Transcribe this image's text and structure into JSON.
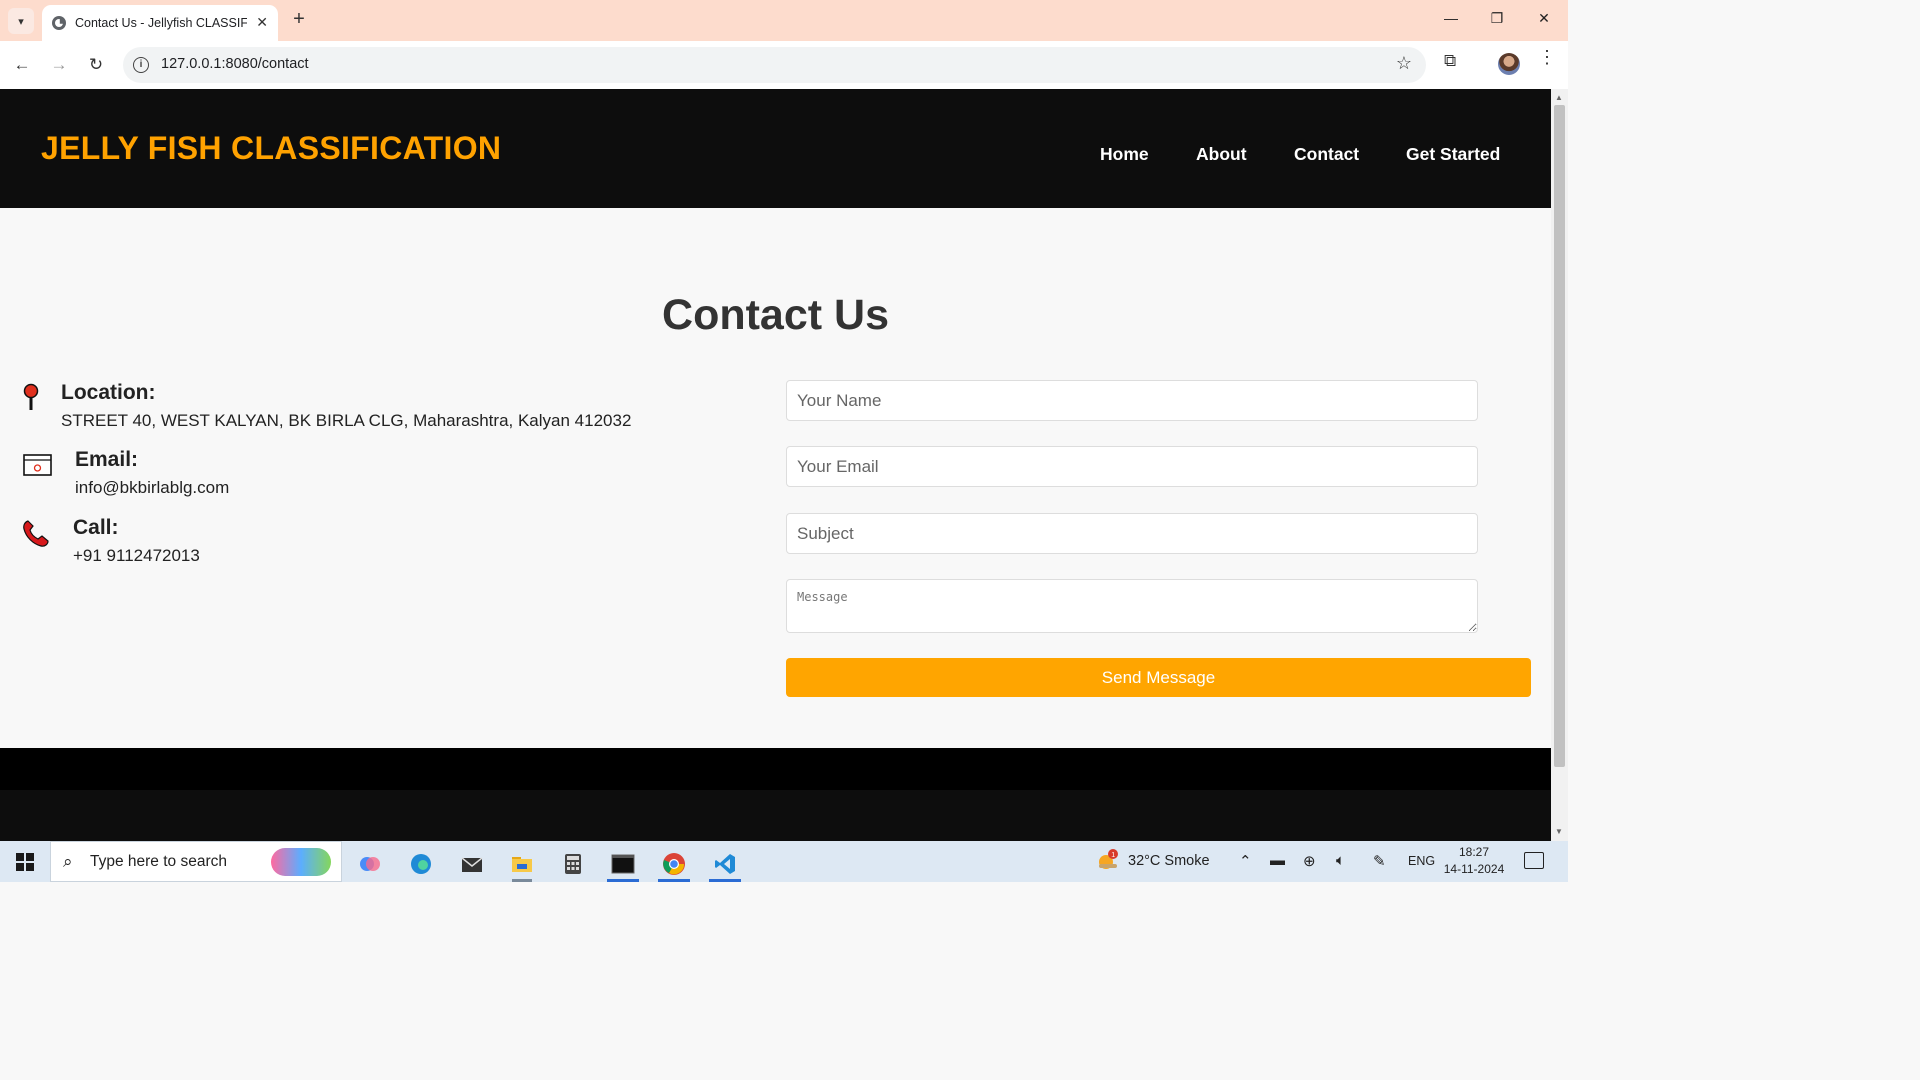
{
  "browser": {
    "tab_title": "Contact Us - Jellyfish CLASSIFICATION",
    "url": "127.0.0.1:8080/contact"
  },
  "site": {
    "title": "JELLY FISH CLASSIFICATION",
    "nav": [
      "Home",
      "About",
      "Contact",
      "Get Started"
    ],
    "accent_color": "#ffa500"
  },
  "page": {
    "heading": "Contact Us",
    "location": {
      "label": "Location:",
      "value": "STREET 40, WEST KALYAN, BK BIRLA CLG, Maharashtra, Kalyan 412032"
    },
    "email": {
      "label": "Email:",
      "value": "info@bkbirlablg.com"
    },
    "call": {
      "label": "Call:",
      "value": "+91 9112472013"
    },
    "form": {
      "name_placeholder": "Your Name",
      "email_placeholder": "Your Email",
      "subject_placeholder": "Subject",
      "message_placeholder": "Message",
      "submit_label": "Send Message"
    }
  },
  "taskbar": {
    "search_placeholder": "Type here to search",
    "weather": "32°C  Smoke",
    "language": "ENG",
    "time": "18:27",
    "date": "14-11-2024"
  }
}
